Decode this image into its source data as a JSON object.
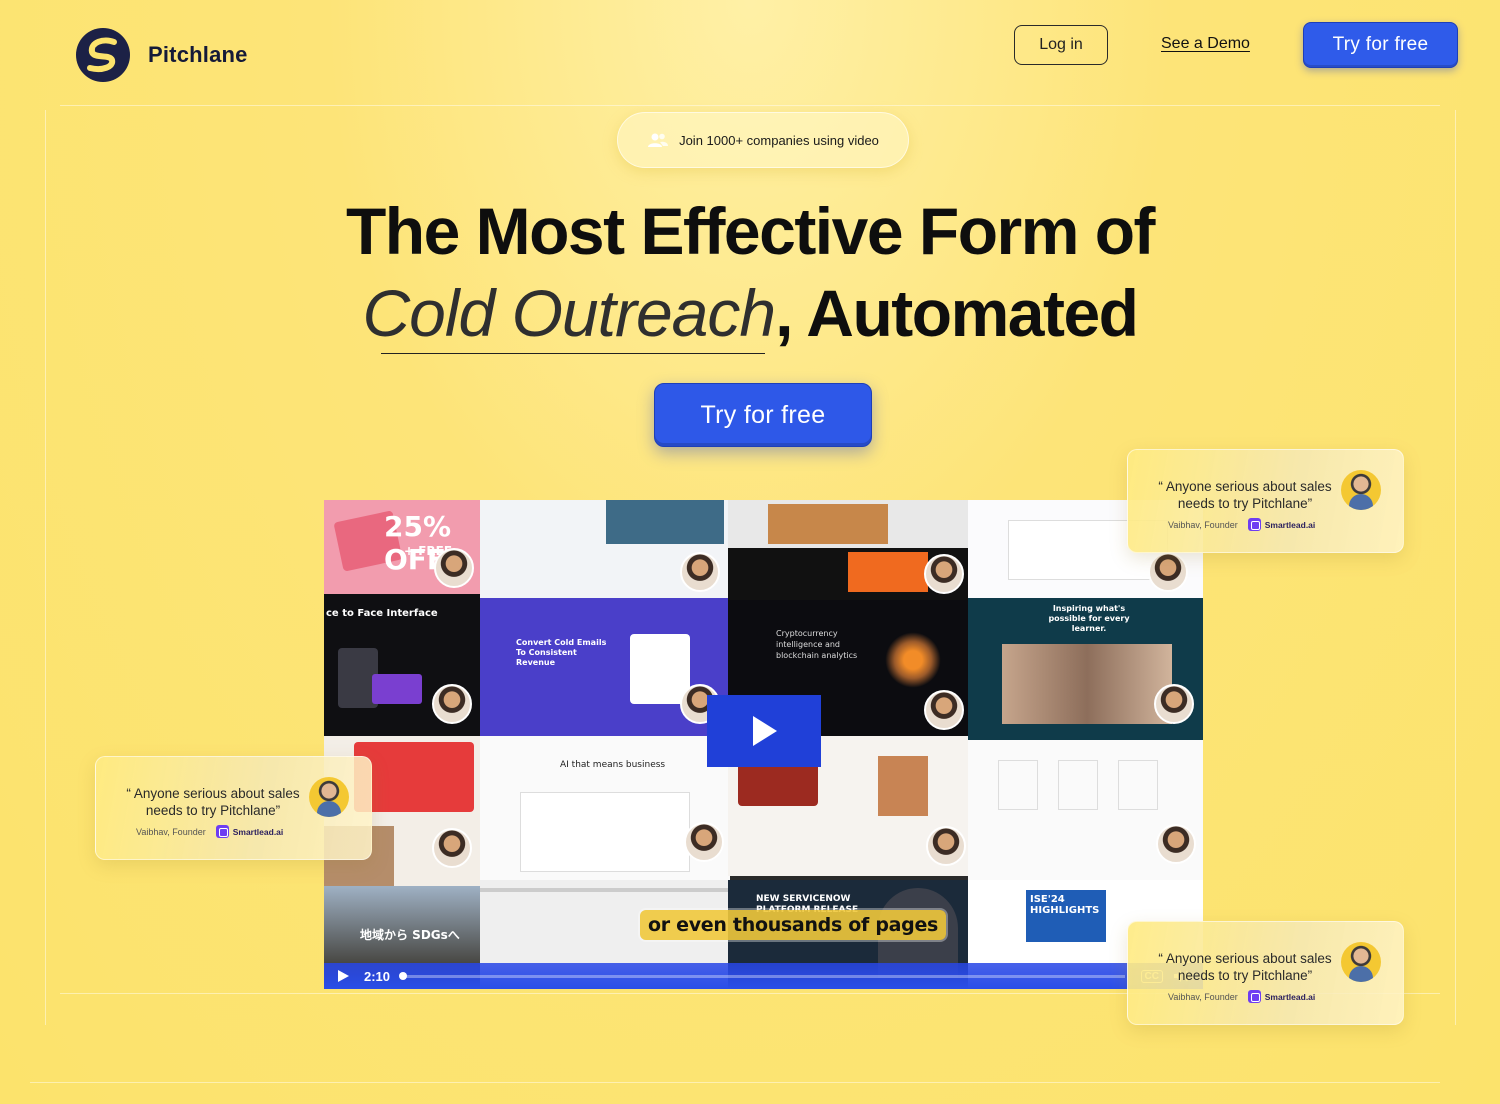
{
  "brand": {
    "name": "Pitchlane",
    "color": "#151a38"
  },
  "nav": {
    "login_label": "Log in",
    "demo_label": "See a Demo",
    "cta_label": "Try for free"
  },
  "hero": {
    "badge_text": "Join 1000+ companies using video",
    "badge_icon": "users-icon",
    "title_line1": "The Most Effective Form of",
    "title_italic": "Cold Outreach",
    "title_comma": ",",
    "title_bold": " Automated",
    "cta_label": "Try for free"
  },
  "video": {
    "subtitle": "or even thousands of pages",
    "time": "2:10",
    "cc_label": "CC",
    "play_icon": "play-icon",
    "volume_icon": "volume-icon",
    "progress": 0.0,
    "tiles": {
      "t1": "25% OFF",
      "t1b": "+ FREE",
      "t2": "ce to Face Interface",
      "t3": "Convert Cold Emails To Consistent Revenue",
      "t4": "Cryptocurrency intelligence and blockchain analytics",
      "t5": "Inspiring what's possible for every learner.",
      "t6": "AI that means business",
      "t7": "NEW SERVICENOW PLATFORM RELEASE",
      "t8": "ISE'24 HIGHLIGHTS",
      "t9": "地域から SDGsへ"
    }
  },
  "testimonials": [
    {
      "quote": "“ Anyone serious about sales needs to try Pitchlane”",
      "author": "Vaibhav, Founder",
      "company": "Smartlead.ai"
    },
    {
      "quote": "“ Anyone serious about sales needs to try Pitchlane”",
      "author": "Vaibhav, Founder",
      "company": "Smartlead.ai"
    },
    {
      "quote": "“ Anyone serious about sales needs to try Pitchlane”",
      "author": "Vaibhav, Founder",
      "company": "Smartlead.ai"
    }
  ],
  "colors": {
    "background": "#fce36c",
    "accent": "#2e58e8",
    "play": "#2040d8"
  }
}
